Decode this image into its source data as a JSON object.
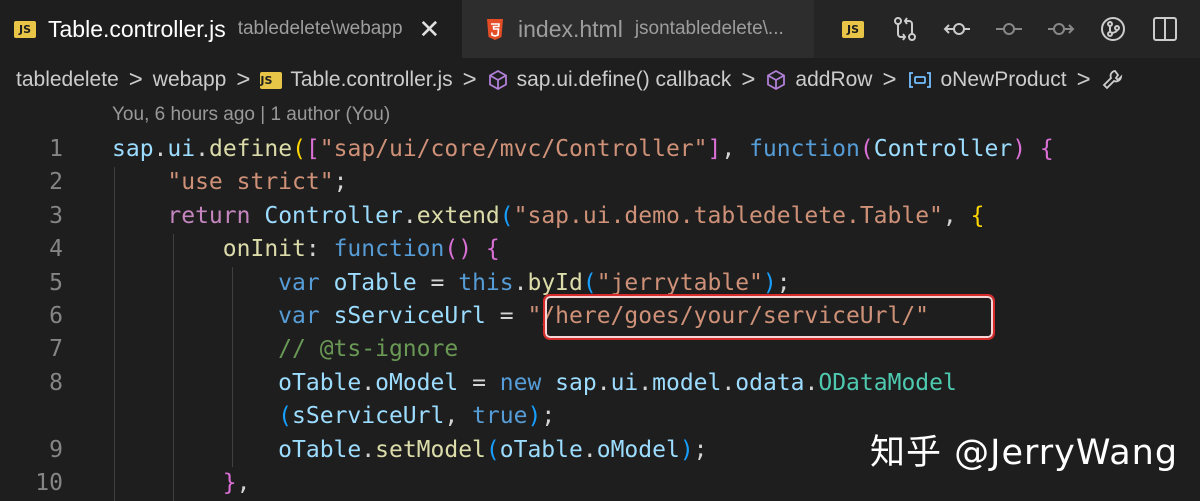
{
  "tabs": {
    "active": {
      "name": "Table.controller.js",
      "desc": "tabledelete\\webapp",
      "icon": "js-file-icon",
      "badge": "JS"
    },
    "inactive": {
      "name": "index.html",
      "desc": "jsontabledelete\\...",
      "icon": "html-file-icon"
    },
    "close_glyph": "✕"
  },
  "toolbar": {
    "badge": "JS",
    "buttons": [
      "js-file-icon",
      "compare-changes-icon",
      "previous-change-icon",
      "git-commit-icon",
      "next-change-icon",
      "source-control-icon",
      "split-editor-icon"
    ]
  },
  "breadcrumb": {
    "items": [
      "tabledelete",
      "webapp",
      "Table.controller.js",
      "sap.ui.define() callback",
      "addRow",
      "oNewProduct"
    ],
    "separator": ">"
  },
  "codelens": "You, 6 hours ago | 1 author (You)",
  "editor": {
    "lines": [
      {
        "num": "1",
        "tokens": [
          {
            "t": "sap",
            "c": "var"
          },
          {
            "t": ".",
            "c": "plain"
          },
          {
            "t": "ui",
            "c": "var"
          },
          {
            "t": ".",
            "c": "plain"
          },
          {
            "t": "define",
            "c": "fn"
          },
          {
            "t": "(",
            "c": "p1"
          },
          {
            "t": "[",
            "c": "p2"
          },
          {
            "t": "\"sap/ui/core/mvc/Controller\"",
            "c": "str"
          },
          {
            "t": "]",
            "c": "p2"
          },
          {
            "t": ", ",
            "c": "plain"
          },
          {
            "t": "function",
            "c": "kw"
          },
          {
            "t": "(",
            "c": "p2"
          },
          {
            "t": "Controller",
            "c": "var"
          },
          {
            "t": ")",
            "c": "p2"
          },
          {
            "t": " ",
            "c": "plain"
          },
          {
            "t": "{",
            "c": "p2"
          }
        ]
      },
      {
        "num": "2",
        "tokens": [
          {
            "t": "    ",
            "c": "plain"
          },
          {
            "t": "\"use strict\"",
            "c": "str"
          },
          {
            "t": ";",
            "c": "plain"
          }
        ]
      },
      {
        "num": "3",
        "tokens": [
          {
            "t": "    ",
            "c": "plain"
          },
          {
            "t": "return",
            "c": "ctl"
          },
          {
            "t": " ",
            "c": "plain"
          },
          {
            "t": "Controller",
            "c": "var"
          },
          {
            "t": ".",
            "c": "plain"
          },
          {
            "t": "extend",
            "c": "fn"
          },
          {
            "t": "(",
            "c": "p3"
          },
          {
            "t": "\"sap.ui.demo.tabledelete.Table\"",
            "c": "str"
          },
          {
            "t": ", ",
            "c": "plain"
          },
          {
            "t": "{",
            "c": "p1"
          }
        ]
      },
      {
        "num": "4",
        "tokens": [
          {
            "t": "        ",
            "c": "plain"
          },
          {
            "t": "onInit",
            "c": "fn"
          },
          {
            "t": ": ",
            "c": "plain"
          },
          {
            "t": "function",
            "c": "kw"
          },
          {
            "t": "()",
            "c": "p2"
          },
          {
            "t": " ",
            "c": "plain"
          },
          {
            "t": "{",
            "c": "p2"
          }
        ]
      },
      {
        "num": "5",
        "tokens": [
          {
            "t": "            ",
            "c": "plain"
          },
          {
            "t": "var",
            "c": "kw"
          },
          {
            "t": " ",
            "c": "plain"
          },
          {
            "t": "oTable",
            "c": "var"
          },
          {
            "t": " = ",
            "c": "plain"
          },
          {
            "t": "this",
            "c": "kw"
          },
          {
            "t": ".",
            "c": "plain"
          },
          {
            "t": "byId",
            "c": "fn"
          },
          {
            "t": "(",
            "c": "p3"
          },
          {
            "t": "\"jerrytable\"",
            "c": "str"
          },
          {
            "t": ")",
            "c": "p3"
          },
          {
            "t": ";",
            "c": "plain"
          }
        ]
      },
      {
        "num": "6",
        "tokens": [
          {
            "t": "            ",
            "c": "plain"
          },
          {
            "t": "var",
            "c": "kw"
          },
          {
            "t": " ",
            "c": "plain"
          },
          {
            "t": "sServiceUrl",
            "c": "var"
          },
          {
            "t": " = ",
            "c": "plain"
          },
          {
            "t": "\"/here/goes/your/serviceUrl/\"",
            "c": "str"
          }
        ]
      },
      {
        "num": "7",
        "tokens": [
          {
            "t": "            ",
            "c": "plain"
          },
          {
            "t": "// @ts-ignore",
            "c": "cmt"
          }
        ]
      },
      {
        "num": "8",
        "tokens": [
          {
            "t": "            ",
            "c": "plain"
          },
          {
            "t": "oTable",
            "c": "var"
          },
          {
            "t": ".",
            "c": "plain"
          },
          {
            "t": "oModel",
            "c": "var"
          },
          {
            "t": " = ",
            "c": "plain"
          },
          {
            "t": "new",
            "c": "kw"
          },
          {
            "t": " ",
            "c": "plain"
          },
          {
            "t": "sap",
            "c": "var"
          },
          {
            "t": ".",
            "c": "plain"
          },
          {
            "t": "ui",
            "c": "var"
          },
          {
            "t": ".",
            "c": "plain"
          },
          {
            "t": "model",
            "c": "var"
          },
          {
            "t": ".",
            "c": "plain"
          },
          {
            "t": "odata",
            "c": "var"
          },
          {
            "t": ".",
            "c": "plain"
          },
          {
            "t": "ODataModel",
            "c": "cls"
          }
        ]
      },
      {
        "num": "",
        "tokens": [
          {
            "t": "            ",
            "c": "plain"
          },
          {
            "t": "(",
            "c": "p3"
          },
          {
            "t": "sServiceUrl",
            "c": "var"
          },
          {
            "t": ", ",
            "c": "plain"
          },
          {
            "t": "true",
            "c": "kw"
          },
          {
            "t": ")",
            "c": "p3"
          },
          {
            "t": ";",
            "c": "plain"
          }
        ]
      },
      {
        "num": "9",
        "tokens": [
          {
            "t": "            ",
            "c": "plain"
          },
          {
            "t": "oTable",
            "c": "var"
          },
          {
            "t": ".",
            "c": "plain"
          },
          {
            "t": "setModel",
            "c": "fn"
          },
          {
            "t": "(",
            "c": "p3"
          },
          {
            "t": "oTable",
            "c": "var"
          },
          {
            "t": ".",
            "c": "plain"
          },
          {
            "t": "oModel",
            "c": "var"
          },
          {
            "t": ")",
            "c": "p3"
          },
          {
            "t": ";",
            "c": "plain"
          }
        ]
      },
      {
        "num": "10",
        "tokens": [
          {
            "t": "        ",
            "c": "plain"
          },
          {
            "t": "}",
            "c": "p2"
          },
          {
            "t": ",",
            "c": "plain"
          }
        ]
      }
    ],
    "highlight_line": "6"
  },
  "watermark": "知乎 @JerryWang",
  "colors": {
    "editor_bg": "#1e1e1e",
    "tabbar_bg": "#252526",
    "highlight_border": "#d52b2b",
    "js_badge": "#e8c547",
    "html_icon": "#e44d26"
  }
}
